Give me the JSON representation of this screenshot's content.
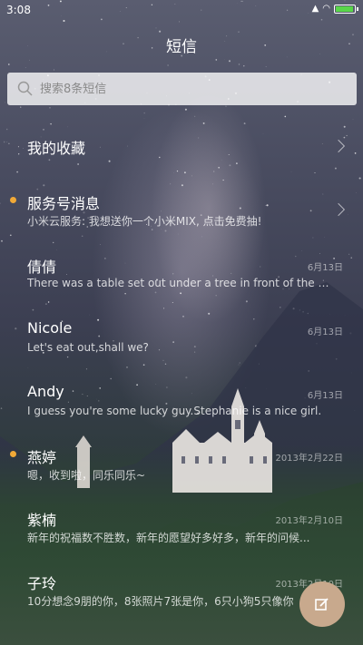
{
  "status_bar": {
    "time": "3:08",
    "battery_level": 0.85
  },
  "header": {
    "title": "短信"
  },
  "search": {
    "placeholder": "搜索8条短信"
  },
  "favorites": {
    "label": "我的收藏"
  },
  "service": {
    "name": "服务号消息",
    "preview": "小米云服务: 我想送你一个小米MIX, 点击免费抽!"
  },
  "conversations": [
    {
      "name": "倩倩",
      "preview": "There was a table set out under a tree in front of the ho...",
      "date": "6月13日"
    },
    {
      "name": "Nicole",
      "preview": "Let's eat out,shall we?",
      "date": "6月13日"
    },
    {
      "name": "Andy",
      "preview": "I guess you're some lucky guy.Stephanie is a nice girl.",
      "date": "6月13日"
    },
    {
      "name": "燕婷",
      "preview": "嗯，收到啦，同乐同乐~",
      "date": "2013年2月22日"
    },
    {
      "name": "紫楠",
      "preview": "新年的祝福数不胜数，新年的愿望好多好多，新年的问候...",
      "date": "2013年2月10日"
    },
    {
      "name": "子玲",
      "preview": "10分想念9朋的你，8张照片7张是你，6只小狗5只像你",
      "date": "2013年2月10日"
    }
  ],
  "colors": {
    "unread_dot": "#f1a937",
    "fab": "#c8a98d",
    "battery": "#59d64a"
  }
}
